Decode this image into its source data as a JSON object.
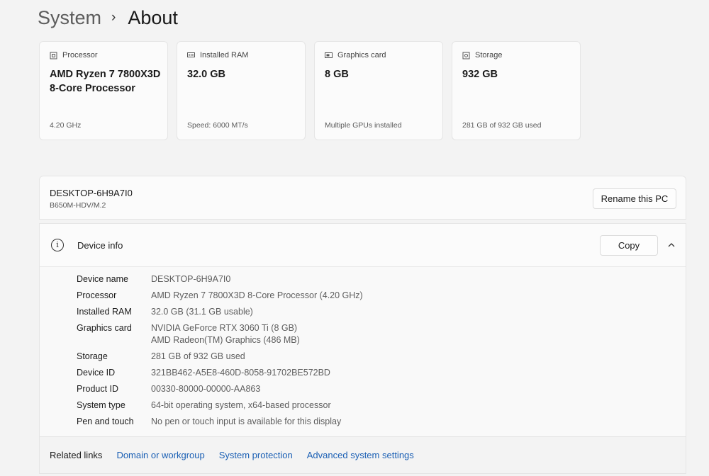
{
  "breadcrumb": {
    "parent": "System",
    "separator": "›",
    "current": "About"
  },
  "cards": [
    {
      "icon": "processor-icon",
      "label": "Processor",
      "value": "AMD Ryzen 7 7800X3D 8-Core Processor",
      "sub": "4.20 GHz"
    },
    {
      "icon": "ram-icon",
      "label": "Installed RAM",
      "value": "32.0 GB",
      "sub": "Speed: 6000 MT/s"
    },
    {
      "icon": "graphics-card-icon",
      "label": "Graphics card",
      "value": "8 GB",
      "sub": "Multiple GPUs installed"
    },
    {
      "icon": "storage-icon",
      "label": "Storage",
      "value": "932 GB",
      "sub": "281 GB of 932 GB used"
    }
  ],
  "pc": {
    "name": "DESKTOP-6H9A7I0",
    "model": "B650M-HDV/M.2",
    "rename_label": "Rename this PC"
  },
  "device_info": {
    "title": "Device info",
    "copy_label": "Copy",
    "specs": [
      {
        "key": "Device name",
        "value": "DESKTOP-6H9A7I0"
      },
      {
        "key": "Processor",
        "value": "AMD Ryzen 7 7800X3D 8-Core Processor (4.20 GHz)"
      },
      {
        "key": "Installed RAM",
        "value": "32.0 GB (31.1 GB usable)"
      },
      {
        "key": "Graphics card",
        "value": "NVIDIA GeForce RTX 3060 Ti (8 GB)",
        "value2": "AMD Radeon(TM) Graphics (486 MB)"
      },
      {
        "key": "Storage",
        "value": "281 GB of 932 GB used"
      },
      {
        "key": "Device ID",
        "value": "321BB462-A5E8-460D-8058-91702BE572BD"
      },
      {
        "key": "Product ID",
        "value": "00330-80000-00000-AA863"
      },
      {
        "key": "System type",
        "value": "64-bit operating system, x64-based processor"
      },
      {
        "key": "Pen and touch",
        "value": "No pen or touch input is available for this display"
      }
    ]
  },
  "related": {
    "label": "Related links",
    "links": [
      "Domain or workgroup",
      "System protection",
      "Advanced system settings"
    ]
  },
  "colors": {
    "link": "#1a5fb4",
    "background": "#f3f3f3",
    "card": "#fbfbfb"
  }
}
